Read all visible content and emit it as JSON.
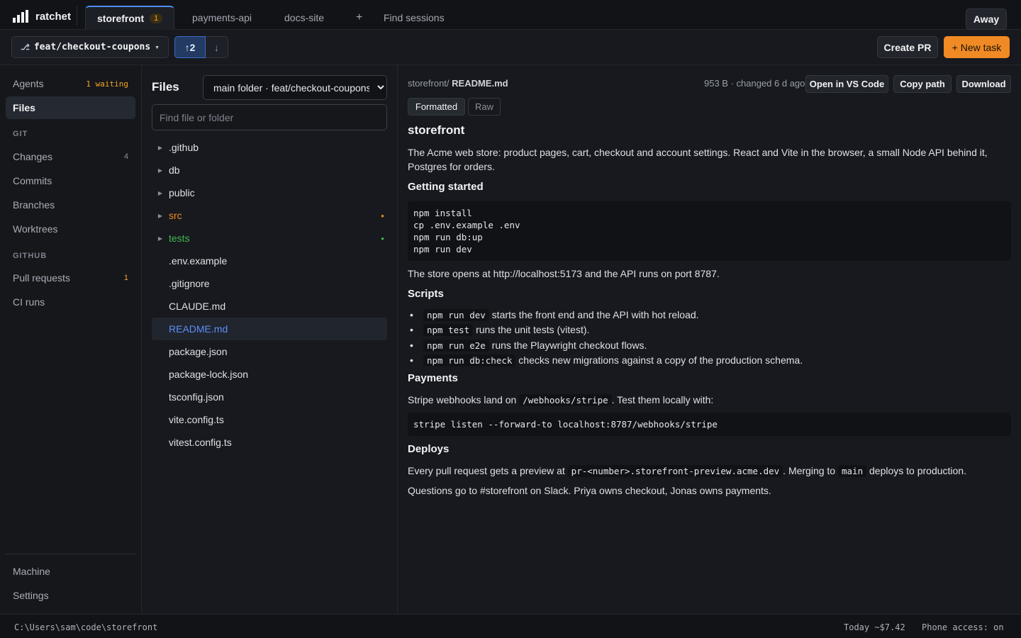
{
  "app": {
    "name": "ratchet"
  },
  "tabs": [
    {
      "label": "storefront",
      "badge": "1"
    },
    {
      "label": "payments-api"
    },
    {
      "label": "docs-site"
    }
  ],
  "tab_add": "+",
  "find_sessions": "Find sessions",
  "away_label": "Away",
  "branch": {
    "name": "feat/checkout-coupons",
    "ahead": "↑2",
    "behind": "↓"
  },
  "actions": {
    "create_pr": "Create PR",
    "new_task": "+ New task"
  },
  "sidebar": {
    "agents": {
      "label": "Agents",
      "count": "1 waiting"
    },
    "files": {
      "label": "Files"
    },
    "git_section": "GIT",
    "changes": {
      "label": "Changes",
      "count": "4"
    },
    "commits": {
      "label": "Commits"
    },
    "branches": {
      "label": "Branches"
    },
    "worktrees": {
      "label": "Worktrees"
    },
    "github_section": "GITHUB",
    "pull_requests": {
      "label": "Pull requests",
      "count": "1"
    },
    "ci_runs": {
      "label": "CI runs"
    },
    "machine": {
      "label": "Machine"
    },
    "settings": {
      "label": "Settings"
    }
  },
  "files_panel": {
    "title": "Files",
    "folder_selected": "main folder · feat/checkout-coupons",
    "search_placeholder": "Find file or folder",
    "tree": [
      {
        "name": ".github",
        "type": "folder"
      },
      {
        "name": "db",
        "type": "folder"
      },
      {
        "name": "public",
        "type": "folder"
      },
      {
        "name": "src",
        "type": "folder",
        "status": "modified"
      },
      {
        "name": "tests",
        "type": "folder",
        "status": "added"
      },
      {
        "name": ".env.example",
        "type": "file"
      },
      {
        "name": ".gitignore",
        "type": "file"
      },
      {
        "name": "CLAUDE.md",
        "type": "file"
      },
      {
        "name": "README.md",
        "type": "file",
        "selected": true
      },
      {
        "name": "package.json",
        "type": "file"
      },
      {
        "name": "package-lock.json",
        "type": "file"
      },
      {
        "name": "tsconfig.json",
        "type": "file"
      },
      {
        "name": "vite.config.ts",
        "type": "file"
      },
      {
        "name": "vitest.config.ts",
        "type": "file"
      }
    ]
  },
  "viewer": {
    "path_prefix": "storefront/",
    "path_file": " README.md",
    "meta": "953 B · changed 6 d ago",
    "open_vscode": "Open in VS Code",
    "copy_path": "Copy path",
    "download": "Download",
    "mode_formatted": "Formatted",
    "mode_raw": "Raw"
  },
  "readme": {
    "title": "storefront",
    "intro": "The Acme web store: product pages, cart, checkout and account settings. React and Vite in the browser, a small Node API behind it, Postgres for orders.",
    "getting_started_heading": "Getting started",
    "getting_started_code": "npm install\ncp .env.example .env\nnpm run db:up\nnpm run dev",
    "store_opens": "The store opens at http://localhost:5173 and the API runs on port 8787.",
    "scripts_heading": "Scripts",
    "scripts": [
      {
        "cmd": "npm run dev",
        "desc": " starts the front end and the API with hot reload."
      },
      {
        "cmd": "npm test",
        "desc": " runs the unit tests (vitest)."
      },
      {
        "cmd": "npm run e2e",
        "desc": " runs the Playwright checkout flows."
      },
      {
        "cmd": "npm run db:check",
        "desc": " checks new migrations against a copy of the production schema."
      }
    ],
    "payments_heading": "Payments",
    "payments_text_before": "Stripe webhooks land on ",
    "payments_code": "/webhooks/stripe",
    "payments_text_after": ". Test them locally with:",
    "payments_command": "stripe listen --forward-to localhost:8787/webhooks/stripe",
    "deploys_heading": "Deploys",
    "deploys_before": "Every pull request gets a preview at ",
    "deploys_code1": "pr-<number>.storefront-preview.acme.dev",
    "deploys_middle": ". Merging to ",
    "deploys_code2": "main",
    "deploys_after": " deploys to production.",
    "questions": "Questions go to #storefront on Slack. Priya owns checkout, Jonas owns payments."
  },
  "status": {
    "path": "C:\\Users\\sam\\code\\storefront",
    "cost": "Today ~$7.42",
    "phone": "Phone access: on"
  },
  "colors": {
    "accent_orange": "#f08a24",
    "accent_blue": "#4f8ef7",
    "status_modified": "#f08a24",
    "status_added": "#3fb950"
  }
}
